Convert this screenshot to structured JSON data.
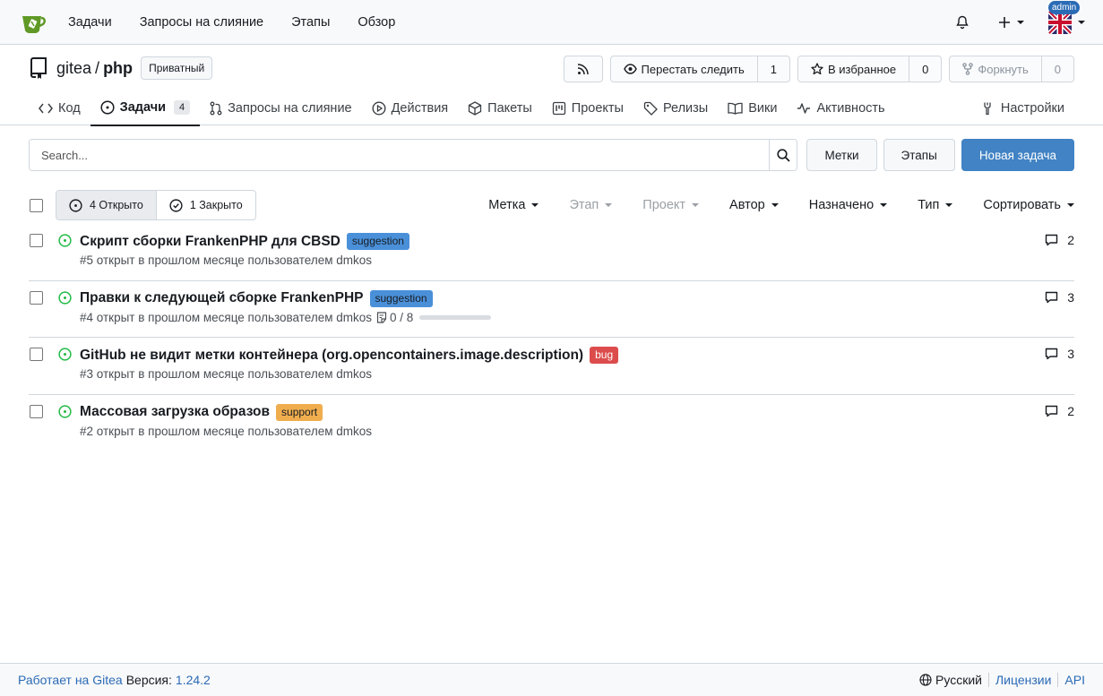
{
  "navbar": {
    "logo_icon": "gitea-logo-icon",
    "links": [
      "Задачи",
      "Запросы на слияние",
      "Этапы",
      "Обзор"
    ],
    "user_badge": "admin"
  },
  "repo": {
    "owner": "gitea",
    "separator": "/",
    "name": "php",
    "visibility": "Приватный",
    "watch_label": "Перестать следить",
    "watch_count": "1",
    "star_label": "В избранное",
    "star_count": "0",
    "fork_label": "Форкнуть",
    "fork_count": "0"
  },
  "tabs": {
    "code": "Код",
    "issues": "Задачи",
    "issues_count": "4",
    "pulls": "Запросы на слияние",
    "actions": "Действия",
    "packages": "Пакеты",
    "projects": "Проекты",
    "releases": "Релизы",
    "wiki": "Вики",
    "activity": "Активность",
    "settings": "Настройки"
  },
  "search": {
    "placeholder": "Search...",
    "labels_button": "Метки",
    "milestones_button": "Этапы",
    "new_issue_button": "Новая задача"
  },
  "filters": {
    "open_label": "4 Открыто",
    "closed_label": "1 Закрыто",
    "label": "Метка",
    "milestone": "Этап",
    "project": "Проект",
    "author": "Автор",
    "assignee": "Назначено",
    "type": "Тип",
    "sort": "Сортировать"
  },
  "issues": [
    {
      "title": "Скрипт сборки FrankenPHP для CBSD",
      "label": "suggestion",
      "meta": "#5 открыт в прошлом месяце пользователем dmkos",
      "comments": "2"
    },
    {
      "title": "Правки к следующей сборке FrankenPHP",
      "label": "suggestion",
      "meta": "#4 открыт в прошлом месяце пользователем dmkos",
      "checklist": "0 / 8",
      "checklist_progress": 0,
      "comments": "3"
    },
    {
      "title": "GitHub не видит метки контейнера (org.opencontainers.image.description)",
      "label": "bug",
      "meta": "#3 открыт в прошлом месяце пользователем dmkos",
      "comments": "3"
    },
    {
      "title": "Массовая загрузка образов",
      "label": "support",
      "meta": "#2 открыт в прошлом месяце пользователем dmkos",
      "comments": "2"
    }
  ],
  "colors": {
    "suggestion": "#4a90d9",
    "bug": "#dc4c4c",
    "support": "#f0ad4e",
    "open_state": "#21ba45",
    "primary": "#4183c4"
  },
  "footer": {
    "powered_by": "Работает на Gitea",
    "version_label": "Версия:",
    "version": "1.24.2",
    "language": "Русский",
    "licenses": "Лицензии",
    "api": "API"
  }
}
